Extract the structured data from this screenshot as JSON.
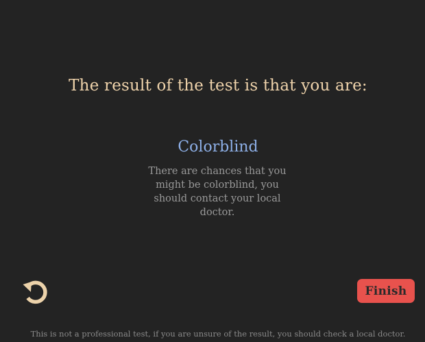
{
  "result": {
    "headline": "The result of the test is that you are:",
    "title": "Colorblind",
    "description": "There are chances that you might be colorblind, you should contact your local doctor."
  },
  "controls": {
    "restart_icon": "restart-icon",
    "finish_label": "Finish"
  },
  "footer": {
    "disclaimer": "This is not a professional test, if you are unsure of the result, you should check a local doctor."
  },
  "colors": {
    "background": "#232323",
    "headline": "#efd3ab",
    "result_title": "#8eb0e8",
    "description": "#9a9a9a",
    "finish_button": "#e8524d",
    "restart_icon": "#ecd2aa"
  }
}
